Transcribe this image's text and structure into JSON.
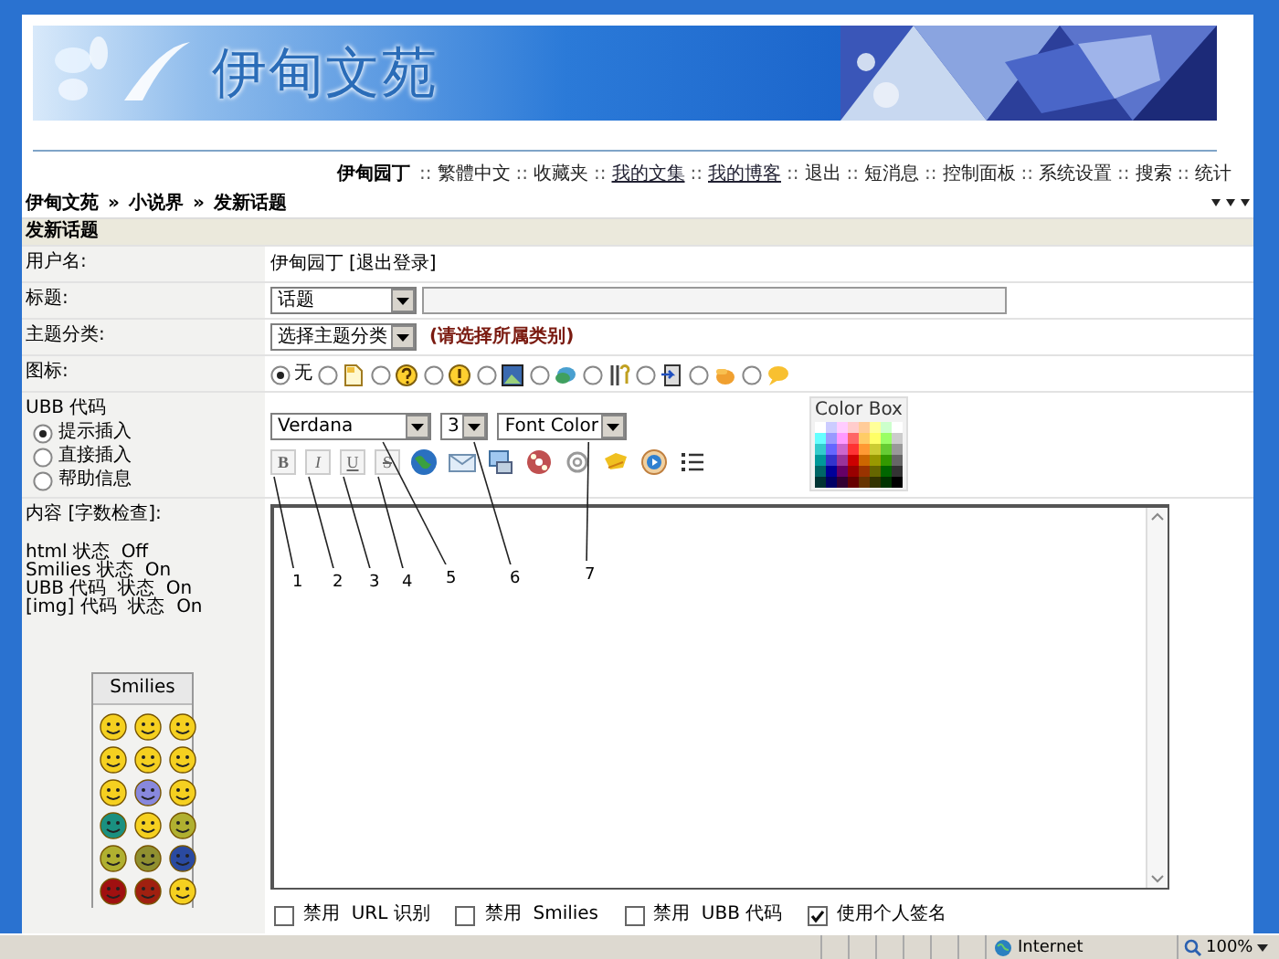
{
  "banner": {
    "title": "伊甸文苑"
  },
  "nav": {
    "user": "伊甸园丁",
    "separator": "::",
    "links": [
      {
        "label": "繁體中文",
        "underlined": false
      },
      {
        "label": "收藏夹",
        "underlined": false
      },
      {
        "label": "我的文集",
        "underlined": true
      },
      {
        "label": "我的博客",
        "underlined": true
      },
      {
        "label": "退出",
        "underlined": false
      },
      {
        "label": "短消息",
        "underlined": false
      },
      {
        "label": "控制面板",
        "underlined": false
      },
      {
        "label": "系统设置",
        "underlined": false
      },
      {
        "label": "搜索",
        "underlined": false
      },
      {
        "label": "统计",
        "underlined": false
      }
    ]
  },
  "breadcrumb": {
    "separator": "»",
    "items": [
      "伊甸文苑",
      "小说界",
      "发新话题"
    ]
  },
  "form": {
    "heading": "发新话题",
    "user_row": {
      "label": "用户名:",
      "value": "伊甸园丁",
      "link": "[退出登录]"
    },
    "title_row": {
      "label": "标题:",
      "select": "话题"
    },
    "category_row": {
      "label": "主题分类:",
      "select": "选择主题分类",
      "hint": "(请选择所属类别)"
    },
    "icon_row": {
      "label": "图标:",
      "options": [
        {
          "label": "无",
          "selected": true
        },
        {
          "selected": false
        },
        {
          "selected": false
        },
        {
          "selected": false
        },
        {
          "selected": false
        },
        {
          "selected": false
        },
        {
          "selected": false
        },
        {
          "selected": false
        },
        {
          "selected": false
        },
        {
          "selected": false
        }
      ]
    },
    "ubb_row": {
      "label": "UBB 代码",
      "modes": [
        {
          "label": "提示插入",
          "selected": true
        },
        {
          "label": "直接插入",
          "selected": false
        },
        {
          "label": "帮助信息",
          "selected": false
        }
      ],
      "font": "Verdana",
      "size": "3",
      "color_select": "Font Color",
      "color_box_title": "Color Box",
      "format_buttons": [
        {
          "label": "B",
          "kind": "bold"
        },
        {
          "label": "I",
          "kind": "italic"
        },
        {
          "label": "U",
          "kind": "underline"
        },
        {
          "label": "S",
          "kind": "strike"
        }
      ],
      "annotations": [
        {
          "label": "1"
        },
        {
          "label": "2"
        },
        {
          "label": "3"
        },
        {
          "label": "4"
        },
        {
          "label": "5"
        },
        {
          "label": "6"
        },
        {
          "label": "7"
        }
      ]
    },
    "content_row": {
      "label": "内容",
      "link": "[字数检查]:",
      "status": [
        "html 状态  Off",
        "Smilies 状态  On",
        "UBB 代码  状态  On",
        "[img] 代码  状态  On"
      ],
      "smilies_title": "Smilies",
      "options": [
        {
          "label": "禁用  URL 识别",
          "checked": false
        },
        {
          "label": "禁用  Smilies",
          "checked": false
        },
        {
          "label": "禁用  UBB 代码",
          "checked": false
        },
        {
          "label": "使用个人签名",
          "checked": true
        }
      ]
    }
  },
  "status_bar": {
    "zone": "Internet",
    "zoom": "100%"
  }
}
